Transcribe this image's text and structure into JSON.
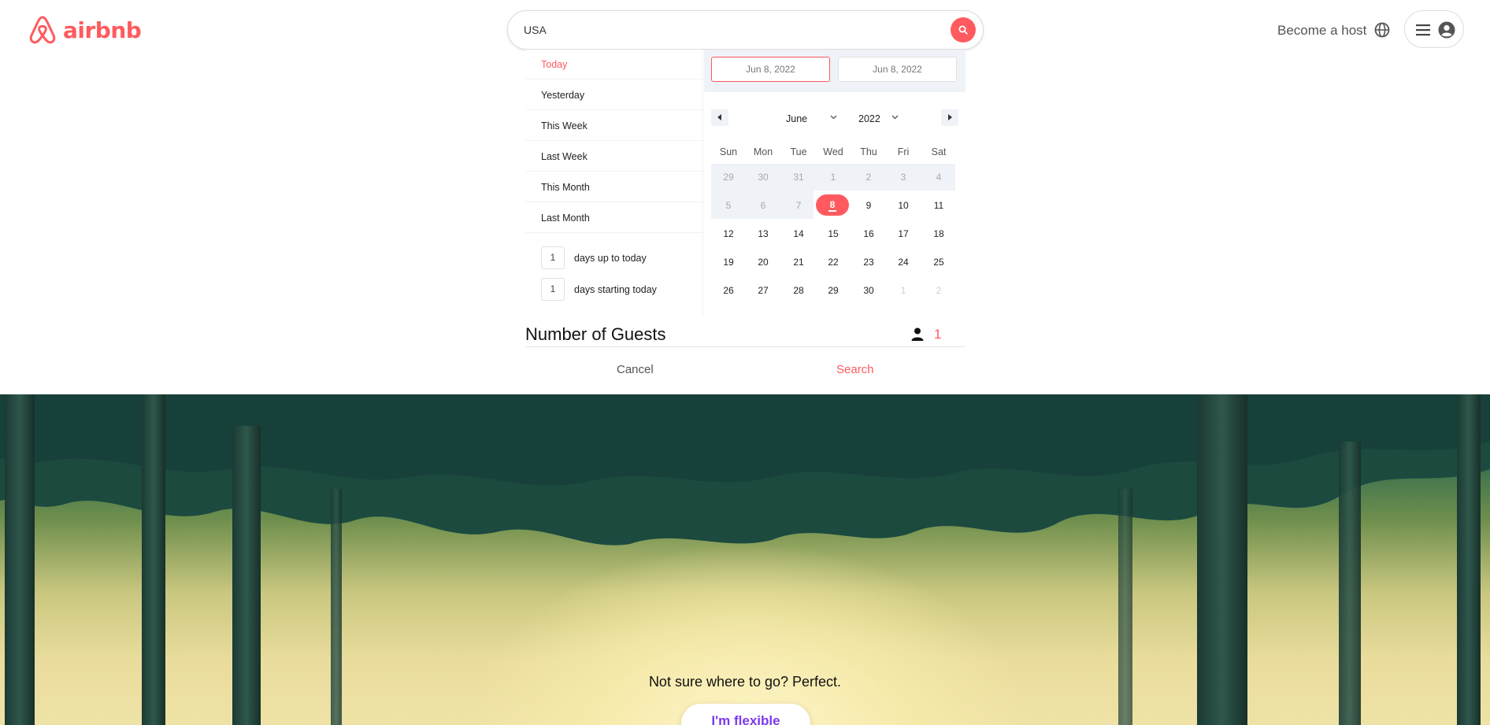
{
  "brand": {
    "name": "airbnb",
    "color": "#ff5a5f"
  },
  "search": {
    "value": "USA"
  },
  "header": {
    "become_host": "Become a host"
  },
  "presets": [
    {
      "label": "Today",
      "active": true
    },
    {
      "label": "Yesterday",
      "active": false
    },
    {
      "label": "This Week",
      "active": false
    },
    {
      "label": "Last Week",
      "active": false
    },
    {
      "label": "This Month",
      "active": false
    },
    {
      "label": "Last Month",
      "active": false
    }
  ],
  "relative_days": [
    {
      "value": "1",
      "label": "days up to today"
    },
    {
      "value": "1",
      "label": "days starting today"
    }
  ],
  "date_range": {
    "start": "Jun 8, 2022",
    "end": "Jun 8, 2022"
  },
  "calendar": {
    "month": "June",
    "year": "2022",
    "weekdays": [
      "Sun",
      "Mon",
      "Tue",
      "Wed",
      "Thu",
      "Fri",
      "Sat"
    ],
    "weeks": [
      [
        "29",
        "30",
        "31",
        "1",
        "2",
        "3",
        "4"
      ],
      [
        "5",
        "6",
        "7",
        "8",
        "9",
        "10",
        "11"
      ],
      [
        "12",
        "13",
        "14",
        "15",
        "16",
        "17",
        "18"
      ],
      [
        "19",
        "20",
        "21",
        "22",
        "23",
        "24",
        "25"
      ],
      [
        "26",
        "27",
        "28",
        "29",
        "30",
        "1",
        "2"
      ]
    ],
    "selected_day": "8"
  },
  "guests": {
    "title": "Number of Guests",
    "count": "1"
  },
  "actions": {
    "cancel": "Cancel",
    "search": "Search"
  },
  "hero": {
    "text": "Not sure where to go? Perfect.",
    "button": "I'm flexible"
  }
}
